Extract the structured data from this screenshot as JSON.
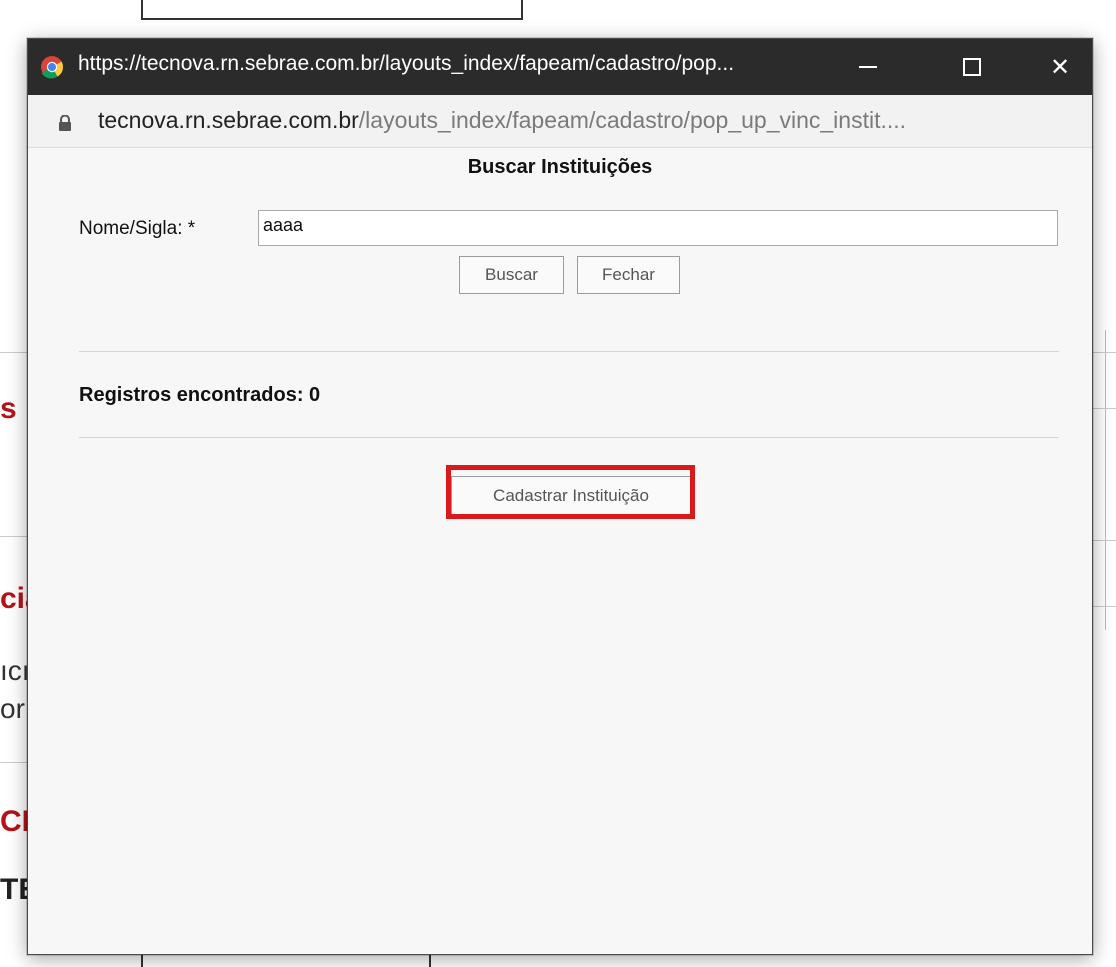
{
  "background": {
    "fragments": [
      "s I",
      "cia",
      "ıcı",
      "or",
      "CN",
      "TE"
    ]
  },
  "window": {
    "title": "https://tecnova.rn.sebrae.com.br/layouts_index/fapeam/cadastro/pop...",
    "url_host": "tecnova.rn.sebrae.com.br",
    "url_path": "/layouts_index/fapeam/cadastro/pop_up_vinc_instit....",
    "icons": {
      "browser": "chrome-icon",
      "minimize": "minimize-icon",
      "maximize": "maximize-icon",
      "close": "close-icon",
      "lock": "lock-icon"
    },
    "close_glyph": "✕"
  },
  "form": {
    "heading": "Buscar Instituições",
    "name_label": "Nome/Sigla: *",
    "name_value": "aaaa",
    "search_button": "Buscar",
    "close_button": "Fechar"
  },
  "results": {
    "records_text": "Registros encontrados: 0",
    "register_button": "Cadastrar Instituição"
  },
  "colors": {
    "highlight": "#d91a1a",
    "background_text": "#b5121b",
    "titlebar": "#2b2b2b"
  }
}
